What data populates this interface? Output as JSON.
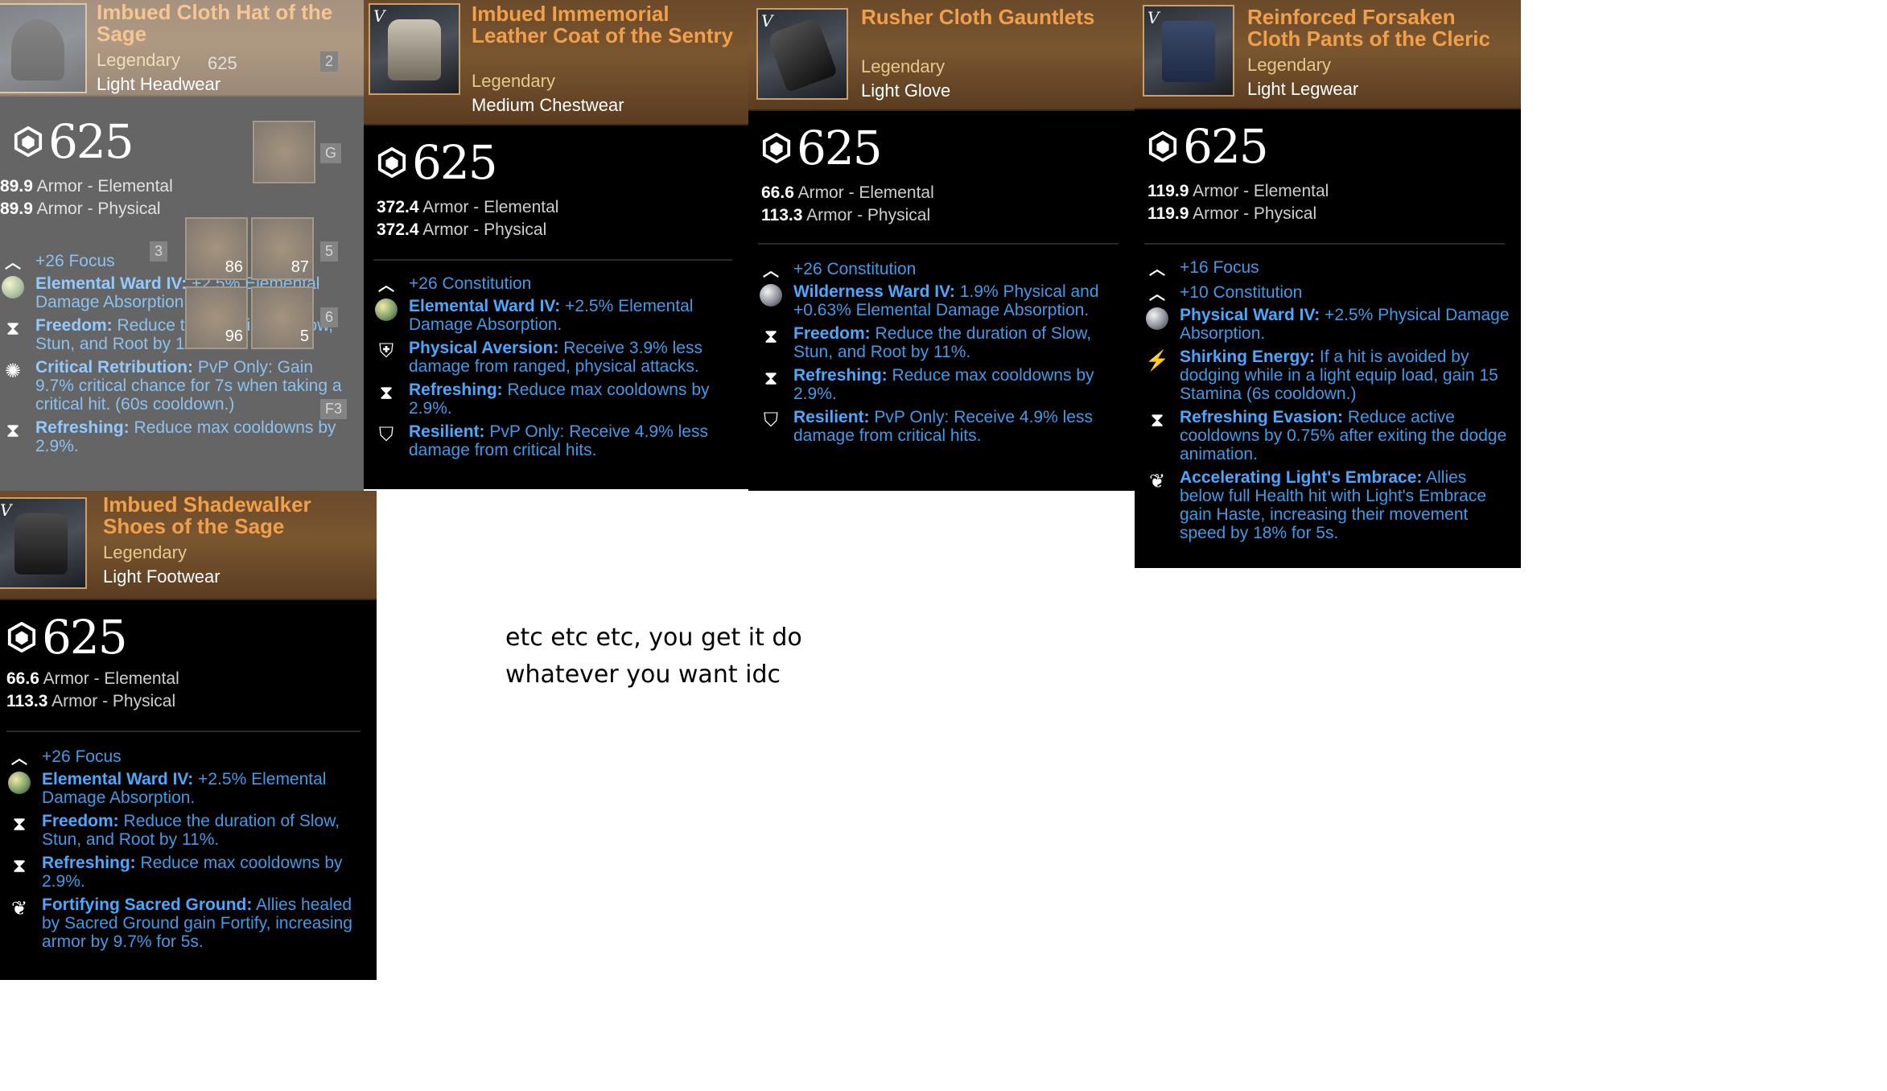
{
  "cards": [
    {
      "title": "Imbued Cloth Hat of the Sage",
      "rarity": "Legendary",
      "type": "Light Headwear",
      "gear_score": "625",
      "armor": [
        {
          "value": "89.9",
          "label": "Armor - Elemental"
        },
        {
          "value": "89.9",
          "label": "Armor - Physical"
        }
      ],
      "attributes": [
        "+26 Focus"
      ],
      "perks": [
        {
          "icon": "elemental-ward-icon",
          "name": "Elemental Ward IV:",
          "desc": "+2.5% Elemental Damage Absorption."
        },
        {
          "icon": "hourglass-icon",
          "name": "Freedom:",
          "desc": "Reduce the duration of Slow, Stun, and Root by 11%."
        },
        {
          "icon": "critical-retribution-icon",
          "name": "Critical Retribution:",
          "desc": "PvP Only: Gain 9.7% critical chance for 7s when taking a critical hit. (60s cooldown.)"
        },
        {
          "icon": "hourglass-icon",
          "name": "Refreshing:",
          "desc": "Reduce max cooldowns by 2.9%."
        }
      ],
      "overlay": {
        "repair_parts": "625",
        "slots": [
          "2",
          "G",
          "3",
          "5",
          "6",
          "F3"
        ],
        "counts": [
          "86",
          "87",
          "96",
          "5"
        ]
      }
    },
    {
      "title": "Imbued Immemorial Leather Coat of the Sentry",
      "rarity": "Legendary",
      "type": "Medium Chestwear",
      "gear_score": "625",
      "armor": [
        {
          "value": "372.4",
          "label": "Armor - Elemental"
        },
        {
          "value": "372.4",
          "label": "Armor - Physical"
        }
      ],
      "attributes": [
        "+26 Constitution"
      ],
      "perks": [
        {
          "icon": "elemental-ward-icon",
          "name": "Elemental Ward IV:",
          "desc": "+2.5% Elemental Damage Absorption."
        },
        {
          "icon": "shield-icon",
          "name": "Physical Aversion:",
          "desc": "Receive 3.9% less damage from ranged, physical attacks."
        },
        {
          "icon": "hourglass-icon",
          "name": "Refreshing:",
          "desc": "Reduce max cooldowns by 2.9%."
        },
        {
          "icon": "resilient-icon",
          "name": "Resilient:",
          "desc": "PvP Only: Receive 4.9% less damage from critical hits."
        }
      ]
    },
    {
      "title": "Rusher Cloth Gauntlets",
      "rarity": "Legendary",
      "type": "Light Glove",
      "gear_score": "625",
      "armor": [
        {
          "value": "66.6",
          "label": "Armor - Elemental"
        },
        {
          "value": "113.3",
          "label": "Armor - Physical"
        }
      ],
      "attributes": [
        "+26 Constitution"
      ],
      "perks": [
        {
          "icon": "wilderness-ward-icon",
          "name": "Wilderness Ward IV:",
          "desc": "1.9% Physical and +0.63% Elemental Damage Absorption."
        },
        {
          "icon": "hourglass-icon",
          "name": "Freedom:",
          "desc": "Reduce the duration of Slow, Stun, and Root by 11%."
        },
        {
          "icon": "hourglass-icon",
          "name": "Refreshing:",
          "desc": "Reduce max cooldowns by 2.9%."
        },
        {
          "icon": "resilient-icon",
          "name": "Resilient:",
          "desc": "PvP Only: Receive 4.9% less damage from critical hits."
        }
      ]
    },
    {
      "title": "Reinforced Forsaken Cloth Pants of the Cleric",
      "rarity": "Legendary",
      "type": "Light Legwear",
      "gear_score": "625",
      "armor": [
        {
          "value": "119.9",
          "label": "Armor - Elemental"
        },
        {
          "value": "119.9",
          "label": "Armor - Physical"
        }
      ],
      "attributes": [
        "+16 Focus",
        "+10 Constitution"
      ],
      "perks": [
        {
          "icon": "physical-ward-icon",
          "name": "Physical Ward IV:",
          "desc": "+2.5% Physical Damage Absorption."
        },
        {
          "icon": "lightning-icon",
          "name": "Shirking Energy:",
          "desc": "If a hit is avoided by dodging while in a light equip load, gain 15 Stamina (6s cooldown.)"
        },
        {
          "icon": "hourglass-icon",
          "name": "Refreshing Evasion:",
          "desc": "Reduce active cooldowns by 0.75% after exiting the dodge animation."
        },
        {
          "icon": "wing-icon",
          "name": "Accelerating Light's Embrace:",
          "desc": "Allies below full Health hit with Light's Embrace gain Haste, increasing their movement speed by 18% for 5s."
        }
      ]
    },
    {
      "title": "Imbued Shadewalker Shoes of the Sage",
      "rarity": "Legendary",
      "type": "Light Footwear",
      "gear_score": "625",
      "armor": [
        {
          "value": "66.6",
          "label": "Armor - Elemental"
        },
        {
          "value": "113.3",
          "label": "Armor - Physical"
        }
      ],
      "attributes": [
        "+26 Focus"
      ],
      "perks": [
        {
          "icon": "elemental-ward-icon",
          "name": "Elemental Ward IV:",
          "desc": "+2.5% Elemental Damage Absorption."
        },
        {
          "icon": "hourglass-icon",
          "name": "Freedom:",
          "desc": "Reduce the duration of Slow, Stun, and Root by 11%."
        },
        {
          "icon": "hourglass-icon",
          "name": "Refreshing:",
          "desc": "Reduce max cooldowns by 2.9%."
        },
        {
          "icon": "wing-icon",
          "name": "Fortifying Sacred Ground:",
          "desc": "Allies healed by Sacred Ground gain Fortify, increasing armor by 9.7% for 5s."
        }
      ]
    }
  ],
  "note": "etc etc etc, you get it do whatever you want idc",
  "item_tier_mark": "V",
  "colors": {
    "title": "#f0a04b",
    "rarity": "#e6c88a",
    "perk_name": "#4aa8ff",
    "perk_text": "#3f9be8",
    "header_bg": "#6b4a2a"
  }
}
